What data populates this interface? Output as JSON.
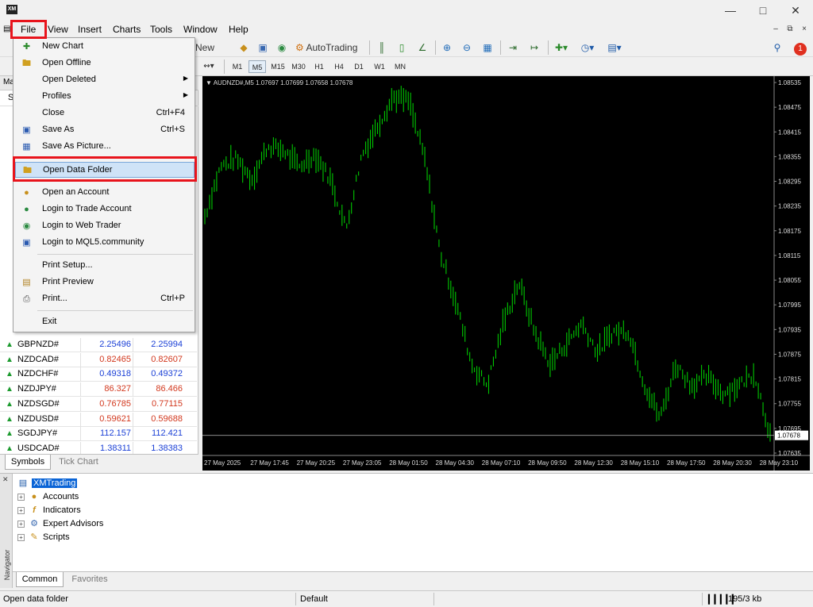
{
  "menu": {
    "items": [
      "File",
      "View",
      "Insert",
      "Charts",
      "Tools",
      "Window",
      "Help"
    ]
  },
  "toolbar": {
    "new_order": "New Order",
    "autotrading": "AutoTrading",
    "notification_count": "1"
  },
  "timeframes": [
    "M1",
    "M5",
    "M15",
    "M30",
    "H1",
    "H4",
    "D1",
    "W1",
    "MN"
  ],
  "timeframes_active": "M5",
  "market_watch": {
    "header_tab": "Ma",
    "header_col": "Sy",
    "rows": [
      {
        "symbol": "GBPNZD#",
        "bid": "2.25496",
        "ask": "2.25994",
        "bid_color": "#1a3fd6",
        "direction": "up"
      },
      {
        "symbol": "NZDCAD#",
        "bid": "0.82465",
        "ask": "0.82607",
        "bid_color": "#d2381e",
        "direction": "up"
      },
      {
        "symbol": "NZDCHF#",
        "bid": "0.49318",
        "ask": "0.49372",
        "bid_color": "#1a3fd6",
        "direction": "up"
      },
      {
        "symbol": "NZDJPY#",
        "bid": "86.327",
        "ask": "86.466",
        "bid_color": "#d2381e",
        "direction": "up"
      },
      {
        "symbol": "NZDSGD#",
        "bid": "0.76785",
        "ask": "0.77115",
        "bid_color": "#d2381e",
        "direction": "up"
      },
      {
        "symbol": "NZDUSD#",
        "bid": "0.59621",
        "ask": "0.59688",
        "bid_color": "#d2381e",
        "direction": "up"
      },
      {
        "symbol": "SGDJPY#",
        "bid": "112.157",
        "ask": "112.421",
        "bid_color": "#1a3fd6",
        "direction": "up"
      },
      {
        "symbol": "USDCAD#",
        "bid": "1.38311",
        "ask": "1.38383",
        "bid_color": "#1a3fd6",
        "direction": "up"
      }
    ],
    "tabs": [
      "Symbols",
      "Tick Chart"
    ]
  },
  "file_menu": {
    "items": [
      {
        "label": "New Chart",
        "icon": "new-chart-icon",
        "shortcut": "",
        "submenu": false
      },
      {
        "label": "Open Offline",
        "icon": "folder-icon",
        "shortcut": "",
        "submenu": false
      },
      {
        "label": "Open Deleted",
        "icon": "",
        "shortcut": "",
        "submenu": true
      },
      {
        "label": "Profiles",
        "icon": "",
        "shortcut": "",
        "submenu": true
      },
      {
        "label": "Close",
        "icon": "",
        "shortcut": "Ctrl+F4",
        "submenu": false
      },
      {
        "label": "Save As",
        "icon": "save-icon",
        "shortcut": "Ctrl+S",
        "submenu": false
      },
      {
        "label": "Save As Picture...",
        "icon": "picture-icon",
        "shortcut": "",
        "submenu": false
      },
      {
        "label": "Open Data Folder",
        "icon": "folder-icon",
        "shortcut": "",
        "submenu": false
      },
      {
        "label": "Open an Account",
        "icon": "account-icon",
        "shortcut": "",
        "submenu": false
      },
      {
        "label": "Login to Trade Account",
        "icon": "login-icon",
        "shortcut": "",
        "submenu": false
      },
      {
        "label": "Login to Web Trader",
        "icon": "web-icon",
        "shortcut": "",
        "submenu": false
      },
      {
        "label": "Login to MQL5.community",
        "icon": "mql5-icon",
        "shortcut": "",
        "submenu": false
      },
      {
        "label": "Print Setup...",
        "icon": "",
        "shortcut": "",
        "submenu": false
      },
      {
        "label": "Print Preview",
        "icon": "preview-icon",
        "shortcut": "",
        "submenu": false
      },
      {
        "label": "Print...",
        "icon": "printer-icon",
        "shortcut": "Ctrl+P",
        "submenu": false
      },
      {
        "label": "Exit",
        "icon": "",
        "shortcut": "",
        "submenu": false
      }
    ],
    "highlighted": "Open Data Folder"
  },
  "chart": {
    "info": "AUDNZD#,M5  1.07697 1.07699 1.07658 1.07678",
    "price_labels": [
      "1.08535",
      "1.08475",
      "1.08415",
      "1.08355",
      "1.08295",
      "1.08235",
      "1.08175",
      "1.08115",
      "1.08055",
      "1.07995",
      "1.07935",
      "1.07875",
      "1.07815",
      "1.07755",
      "1.07695",
      "1.07635"
    ],
    "current_price": "1.07678",
    "time_labels": [
      "27 May 2025",
      "27 May 17:45",
      "27 May 20:25",
      "27 May 23:05",
      "28 May 01:50",
      "28 May 04:30",
      "28 May 07:10",
      "28 May 09:50",
      "28 May 12:30",
      "28 May 15:10",
      "28 May 17:50",
      "28 May 20:30",
      "28 May 23:10"
    ],
    "candle_color": "#00c800"
  },
  "chart_data": {
    "type": "line",
    "symbol": "AUDNZD#",
    "timeframe": "M5",
    "ylim": [
      1.07635,
      1.08535
    ],
    "x": [
      "27 May 2025",
      "27 May 17:45",
      "27 May 20:25",
      "27 May 23:05",
      "28 May 01:50",
      "28 May 04:30",
      "28 May 07:10",
      "28 May 09:50",
      "28 May 12:30",
      "28 May 15:10",
      "28 May 17:50",
      "28 May 20:30",
      "28 May 23:10"
    ],
    "series": [
      {
        "values": [
          1.0821,
          1.0833,
          1.0835,
          1.083,
          1.0838,
          1.0837,
          1.0833,
          1.0836,
          1.083,
          1.0818,
          1.0836,
          1.0843,
          1.085,
          1.0849,
          1.0835,
          1.0812,
          1.08,
          1.0785,
          1.078,
          1.0795,
          1.0805,
          1.0793,
          1.0785,
          1.079,
          1.0795,
          1.0788,
          1.0793,
          1.0793,
          1.078,
          1.0772,
          1.0785,
          1.078,
          1.0782,
          1.0778,
          1.078,
          1.0783,
          1.0768
        ]
      }
    ]
  },
  "navigator": {
    "root": "XMTrading",
    "items": [
      "Accounts",
      "Indicators",
      "Expert Advisors",
      "Scripts"
    ],
    "tabs": [
      "Common",
      "Favorites"
    ],
    "side_label": "Navigator"
  },
  "status": {
    "left": "Open data folder",
    "profile": "Default",
    "traffic": "195/3 kb"
  }
}
